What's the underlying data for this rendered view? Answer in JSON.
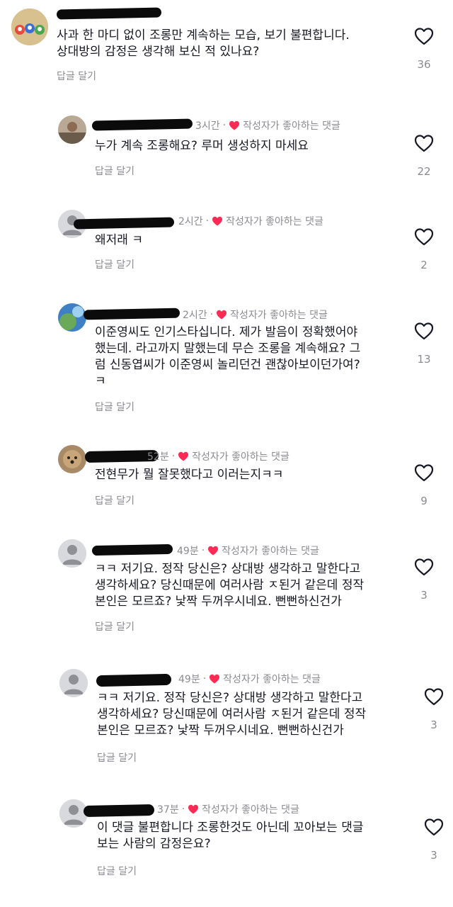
{
  "comments": [
    {
      "time": "",
      "creator_liked": "",
      "text": "사과 한 마디 없이 조롱만 계속하는 모습, 보기 불편합니다.\n상대방의 감정은 생각해 보신 적 있나요?",
      "reply_label": "답글 달기",
      "likes": "36"
    },
    {
      "time": "3시간",
      "creator_liked": "작성자가 좋아하는 댓글",
      "text": "누가 계속 조롱해요? 루머 생성하지 마세요",
      "reply_label": "답글 달기",
      "likes": "22"
    },
    {
      "time": "2시간",
      "creator_liked": "작성자가 좋아하는 댓글",
      "text": "왜저래 ㅋ",
      "reply_label": "답글 달기",
      "likes": "2"
    },
    {
      "time": "2시간",
      "creator_liked": "작성자가 좋아하는 댓글",
      "text": "이준영씨도 인기스타십니다. 제가 발음이 정확했어야\n했는데. 라고까지 말했는데 무슨 조롱을 계속해요? 그\n럼 신동엽씨가 이준영씨 놀리던건 괜찮아보이던가여?\nㅋ",
      "reply_label": "답글 달기",
      "likes": "13"
    },
    {
      "time": "52분",
      "creator_liked": "작성자가 좋아하는 댓글",
      "text": "전현무가 뭘 잘못했다고 이러는지ㅋㅋ",
      "reply_label": "답글 달기",
      "likes": "9"
    },
    {
      "time": "49분",
      "creator_liked": "작성자가 좋아하는 댓글",
      "text": "ㅋㅋ 저기요. 정작 당신은? 상대방 생각하고 말한다고\n생각하세요? 당신때문에 여러사람 ㅈ된거 같은데 정작\n본인은 모르죠? 낯짝 두꺼우시네요. 뻔뻔하신건가",
      "reply_label": "답글 달기",
      "likes": "3"
    },
    {
      "time": "49분",
      "creator_liked": "작성자가 좋아하는 댓글",
      "text": "ㅋㅋ 저기요. 정작 당신은? 상대방 생각하고 말한다고\n생각하세요? 당신때문에 여러사람 ㅈ된거 같은데 정작\n본인은 모르죠? 낯짝 두꺼우시네요. 뻔뻔하신건가",
      "reply_label": "답글 달기",
      "likes": "3"
    },
    {
      "time": "37분",
      "creator_liked": "작성자가 좋아하는 댓글",
      "text": "이 댓글 불편합니다 조롱한것도 아닌데 꼬아보는 댓글\n보는 사람의 감정은요?",
      "reply_label": "답글 달기",
      "likes": "3"
    }
  ],
  "colors": {
    "heart_red": "#fe2c55",
    "muted_text": "#8a8b91",
    "body_text": "#161823"
  },
  "icons": {
    "like": "heart-outline-icon",
    "creator_liked": "heart-filled-icon",
    "avatar": "default-avatar-icon"
  }
}
